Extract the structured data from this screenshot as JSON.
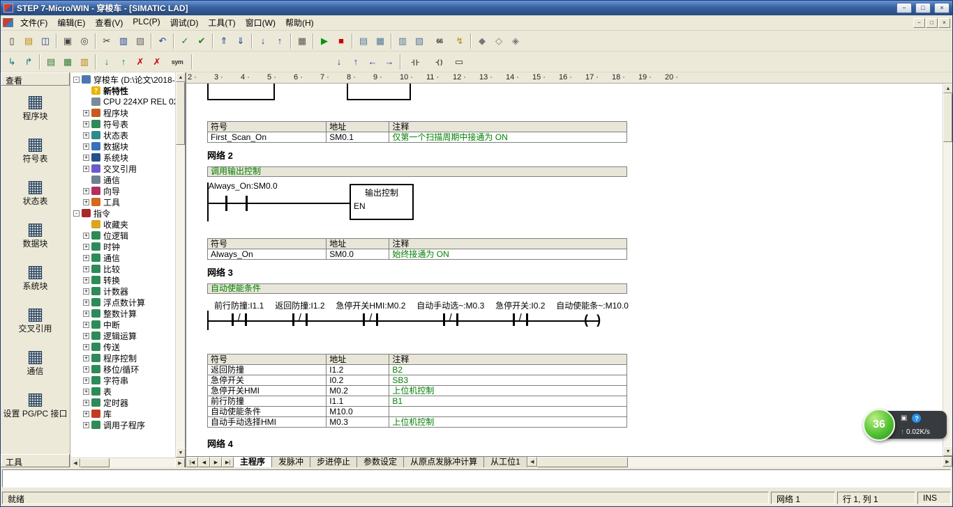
{
  "window": {
    "title": "STEP 7-Micro/WIN - 穿梭车 - [SIMATIC LAD]",
    "min": "−",
    "max": "□",
    "close": "×"
  },
  "menu": {
    "items": [
      "文件(F)",
      "编辑(E)",
      "查看(V)",
      "PLC(P)",
      "调试(D)",
      "工具(T)",
      "窗口(W)",
      "帮助(H)"
    ],
    "mdi": {
      "min": "−",
      "restore": "□",
      "close": "×"
    }
  },
  "scroll": {
    "up": "▲",
    "down": "▼",
    "left": "◀",
    "right": "▶"
  },
  "toolbars": {
    "row1": [
      {
        "n": "new-file",
        "g": "▯",
        "c": "#333333"
      },
      {
        "n": "open-folder",
        "g": "▤",
        "c": "#c08a10"
      },
      {
        "n": "save",
        "g": "◫",
        "c": "#1c3f94"
      },
      {
        "sep": true
      },
      {
        "n": "print",
        "g": "▣",
        "c": "#444444"
      },
      {
        "n": "print-preview",
        "g": "◎",
        "c": "#444444"
      },
      {
        "sep": true
      },
      {
        "n": "cut",
        "g": "✂",
        "c": "#333333"
      },
      {
        "n": "copy",
        "g": "▥",
        "c": "#1c3f94"
      },
      {
        "n": "paste",
        "g": "▧",
        "c": "#666666"
      },
      {
        "sep": true
      },
      {
        "n": "undo",
        "g": "↶",
        "c": "#1c3f94"
      },
      {
        "sep": true
      },
      {
        "n": "compile",
        "g": "✓",
        "c": "#1c7a1c"
      },
      {
        "n": "compile-all",
        "g": "✔",
        "c": "#1c7a1c"
      },
      {
        "sep": true
      },
      {
        "n": "upload",
        "g": "⇑",
        "c": "#1c3f94"
      },
      {
        "n": "download",
        "g": "⇓",
        "c": "#1c3f94"
      },
      {
        "sep": true
      },
      {
        "n": "sort-ascending",
        "g": "↓",
        "c": "#1c3f94"
      },
      {
        "n": "sort-descending",
        "g": "↑",
        "c": "#1c3f94"
      },
      {
        "sep": true
      },
      {
        "n": "options-table",
        "g": "▦",
        "c": "#555555"
      },
      {
        "sep": true
      },
      {
        "n": "run",
        "g": "▶",
        "c": "#0a930a"
      },
      {
        "n": "stop",
        "g": "■",
        "c": "#cc0000"
      },
      {
        "sep": true
      },
      {
        "n": "program-status-chart",
        "g": "▤",
        "c": "#557799"
      },
      {
        "n": "pause-status-chart",
        "g": "▦",
        "c": "#557799"
      },
      {
        "sep": true
      },
      {
        "n": "status-table-read",
        "g": "▥",
        "c": "#557799"
      },
      {
        "n": "trend-view",
        "g": "▧",
        "c": "#557799"
      },
      {
        "n": "glasses-monitor",
        "g": "66",
        "c": "#333333",
        "wide": true
      },
      {
        "n": "force-values",
        "g": "↯",
        "c": "#b8860b"
      },
      {
        "sep": true
      },
      {
        "n": "bookmark-toggle",
        "g": "◆",
        "c": "#777777"
      },
      {
        "n": "bookmark-next",
        "g": "◇",
        "c": "#777777"
      },
      {
        "n": "bookmark-clear",
        "g": "◈",
        "c": "#777777"
      }
    ],
    "row2": [
      {
        "n": "ladder-branch-down",
        "g": "↳",
        "c": "#0a7a7a"
      },
      {
        "n": "ladder-branch-up",
        "g": "↱",
        "c": "#0a7a7a"
      },
      {
        "sep": true
      },
      {
        "n": "view-program-block",
        "g": "▤",
        "c": "#2e7d32"
      },
      {
        "n": "view-symbol-table",
        "g": "▦",
        "c": "#2e7d32"
      },
      {
        "n": "view-status-chart",
        "g": "▥",
        "c": "#b8860b"
      },
      {
        "sep": true
      },
      {
        "n": "insert-row",
        "g": "↓",
        "c": "#0a7a7a"
      },
      {
        "n": "insert-network",
        "g": "↑",
        "c": "#0a7a7a"
      },
      {
        "n": "delete-row",
        "g": "✗",
        "c": "#cc0000"
      },
      {
        "n": "delete-network",
        "g": "✗",
        "c": "#cc0000"
      },
      {
        "n": "toggle-symbolic-addressing",
        "g": "sym",
        "c": "#333333",
        "wide": true
      },
      {
        "sep": true
      },
      {
        "spacer": true
      },
      {
        "n": "goto-next-down",
        "g": "↓",
        "c": "#1c3f94"
      },
      {
        "n": "goto-next-up",
        "g": "↑",
        "c": "#1c3f94"
      },
      {
        "n": "goto-left",
        "g": "←",
        "c": "#1c3f94"
      },
      {
        "n": "goto-right",
        "g": "→",
        "c": "#1c3f94"
      },
      {
        "sep": true
      },
      {
        "n": "insert-contact",
        "g": "-| |-",
        "c": "#333333",
        "wide": true
      },
      {
        "n": "insert-coil",
        "g": "-( )",
        "c": "#333333",
        "wide": true
      },
      {
        "n": "insert-box",
        "g": "▭",
        "c": "#333333"
      }
    ]
  },
  "viewbar": {
    "header": "查看",
    "icon_glyph": "▦",
    "items": [
      "程序块",
      "符号表",
      "状态表",
      "数据块",
      "系统块",
      "交叉引用",
      "通信",
      "设置 PG/PC 接口"
    ],
    "footer": "工具"
  },
  "tree": {
    "items": [
      {
        "label": "穿梭车 (D:\\论文\\2018-",
        "lvl": 0,
        "exp": "-",
        "c": "#4a78b0",
        "g": ""
      },
      {
        "label": "新特性",
        "lvl": 1,
        "exp": "",
        "c": "#e8b500",
        "g": "?",
        "bold": true
      },
      {
        "label": "CPU 224XP REL 02",
        "lvl": 1,
        "exp": "",
        "c": "#7a8a99",
        "g": ""
      },
      {
        "label": "程序块",
        "lvl": 1,
        "exp": "+",
        "c": "#c85a1e",
        "g": ""
      },
      {
        "label": "符号表",
        "lvl": 1,
        "exp": "+",
        "c": "#2e8b57",
        "g": ""
      },
      {
        "label": "状态表",
        "lvl": 1,
        "exp": "+",
        "c": "#2e8b8b",
        "g": ""
      },
      {
        "label": "数据块",
        "lvl": 1,
        "exp": "+",
        "c": "#3a6ebf",
        "g": ""
      },
      {
        "label": "系统块",
        "lvl": 1,
        "exp": "+",
        "c": "#24508c",
        "g": ""
      },
      {
        "label": "交叉引用",
        "lvl": 1,
        "exp": "+",
        "c": "#6a5acd",
        "g": ""
      },
      {
        "label": "通信",
        "lvl": 1,
        "exp": "",
        "c": "#708090",
        "g": ""
      },
      {
        "label": "向导",
        "lvl": 1,
        "exp": "+",
        "c": "#b03060",
        "g": ""
      },
      {
        "label": "工具",
        "lvl": 1,
        "exp": "+",
        "c": "#d2691e",
        "g": ""
      },
      {
        "label": "指令",
        "lvl": 0,
        "exp": "-",
        "c": "#a52a2a",
        "g": ""
      },
      {
        "label": "收藏夹",
        "lvl": 1,
        "exp": "",
        "c": "#daa520",
        "g": ""
      },
      {
        "label": "位逻辑",
        "lvl": 1,
        "exp": "+",
        "c": "#2e8b57",
        "g": ""
      },
      {
        "label": "时钟",
        "lvl": 1,
        "exp": "+",
        "c": "#2e8b57",
        "g": ""
      },
      {
        "label": "通信",
        "lvl": 1,
        "exp": "+",
        "c": "#2e8b57",
        "g": ""
      },
      {
        "label": "比较",
        "lvl": 1,
        "exp": "+",
        "c": "#2e8b57",
        "g": ""
      },
      {
        "label": "转换",
        "lvl": 1,
        "exp": "+",
        "c": "#2e8b57",
        "g": ""
      },
      {
        "label": "计数器",
        "lvl": 1,
        "exp": "+",
        "c": "#2e8b57",
        "g": ""
      },
      {
        "label": "浮点数计算",
        "lvl": 1,
        "exp": "+",
        "c": "#2e8b57",
        "g": ""
      },
      {
        "label": "整数计算",
        "lvl": 1,
        "exp": "+",
        "c": "#2e8b57",
        "g": ""
      },
      {
        "label": "中断",
        "lvl": 1,
        "exp": "+",
        "c": "#2e8b57",
        "g": ""
      },
      {
        "label": "逻辑运算",
        "lvl": 1,
        "exp": "+",
        "c": "#2e8b57",
        "g": ""
      },
      {
        "label": "传送",
        "lvl": 1,
        "exp": "+",
        "c": "#2e8b57",
        "g": ""
      },
      {
        "label": "程序控制",
        "lvl": 1,
        "exp": "+",
        "c": "#2e8b57",
        "g": ""
      },
      {
        "label": "移位/循环",
        "lvl": 1,
        "exp": "+",
        "c": "#2e8b57",
        "g": ""
      },
      {
        "label": "字符串",
        "lvl": 1,
        "exp": "+",
        "c": "#2e8b57",
        "g": ""
      },
      {
        "label": "表",
        "lvl": 1,
        "exp": "+",
        "c": "#2e8b57",
        "g": ""
      },
      {
        "label": "定时器",
        "lvl": 1,
        "exp": "+",
        "c": "#2e8b57",
        "g": ""
      },
      {
        "label": "库",
        "lvl": 1,
        "exp": "+",
        "c": "#c23b22",
        "g": ""
      },
      {
        "label": "调用子程序",
        "lvl": 1,
        "exp": "+",
        "c": "#2e8b57",
        "g": ""
      }
    ]
  },
  "editor": {
    "ruler": {
      "start": 2,
      "end": 20
    },
    "networks": {
      "n1": {
        "table": {
          "headers": [
            "符号",
            "地址",
            "注释"
          ],
          "rows": [
            [
              "First_Scan_On",
              "SM0.1",
              "仅第一个扫描周期中接通为 ON"
            ]
          ]
        }
      },
      "n2": {
        "title": "网络 2",
        "comment": "调用输出控制",
        "contact_label": "Always_On:SM0.0",
        "box_title": "输出控制",
        "box_en": "EN",
        "table": {
          "headers": [
            "符号",
            "地址",
            "注释"
          ],
          "rows": [
            [
              "Always_On",
              "SM0.0",
              "始终接通为 ON"
            ]
          ]
        }
      },
      "n3": {
        "title": "网络 3",
        "comment": "自动使能条件",
        "elements": [
          {
            "label": "前行防撞:I1.1",
            "type": "nc"
          },
          {
            "label": "返回防撞:I1.2",
            "type": "nc"
          },
          {
            "label": "急停开关HMI:M0.2",
            "type": "nc"
          },
          {
            "label": "自动手动选~:M0.3",
            "type": "nc"
          },
          {
            "label": "急停开关:I0.2",
            "type": "nc"
          },
          {
            "label": "自动使能条~:M10.0",
            "type": "coil"
          }
        ],
        "table": {
          "headers": [
            "符号",
            "地址",
            "注释"
          ],
          "rows": [
            [
              "返回防撞",
              "I1.2",
              "B2"
            ],
            [
              "急停开关",
              "I0.2",
              "SB3"
            ],
            [
              "急停开关HMI",
              "M0.2",
              "上位机控制"
            ],
            [
              "前行防撞",
              "I1.1",
              "B1"
            ],
            [
              "自动使能条件",
              "M10.0",
              ""
            ],
            [
              "自动手动选择HMI",
              "M0.3",
              "上位机控制"
            ]
          ]
        }
      },
      "n4": {
        "title": "网络 4"
      }
    }
  },
  "tabbar": {
    "scroll": [
      "|◀",
      "◀",
      "▶",
      "▶|"
    ],
    "tabs": [
      {
        "label": "主程序",
        "active": true
      },
      {
        "label": "发脉冲",
        "active": false
      },
      {
        "label": "步进停止",
        "active": false
      },
      {
        "label": "参数设定",
        "active": false
      },
      {
        "label": "从原点发脉冲计算",
        "active": false
      },
      {
        "label": "从工位1",
        "active": false
      }
    ]
  },
  "statusbar": {
    "ready": "就绪",
    "network": "网络 1",
    "position": "行 1, 列 1",
    "mode": "INS"
  },
  "widget": {
    "ball": "36",
    "cam": "▣",
    "help": "?",
    "speed_arrow": "↑",
    "speed": "0.02K/s"
  }
}
